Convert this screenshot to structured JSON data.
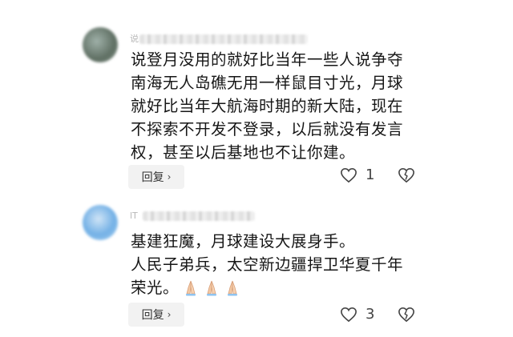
{
  "comments": [
    {
      "name_prefix": "说",
      "body": "说登月没用的就好比当年一些人说争夺\n南海无人岛礁无用一样鼠目寸光，月球\n就好比当年大航海时期的新大陆，现在\n不探索不开发不登录，以后就没有发言\n权，甚至以后基地也不让你建。",
      "reply_label": "回复",
      "reply_chevron": "›",
      "like_count": "1",
      "icons": [
        "heart-outline-icon",
        "broken-heart-icon",
        "chevron-right-icon"
      ]
    },
    {
      "name_prefix": "lT",
      "body": "基建狂魔，月球建设大展身手。\n人民子弟兵，太空新边疆捍卫华夏千年\n荣光。",
      "emojis": [
        "🙏",
        "🙏",
        "🙏"
      ],
      "reply_label": "回复",
      "reply_chevron": "›",
      "like_count": "3",
      "icons": [
        "heart-outline-icon",
        "broken-heart-icon",
        "chevron-right-icon",
        "praying-hands-icon"
      ]
    }
  ]
}
